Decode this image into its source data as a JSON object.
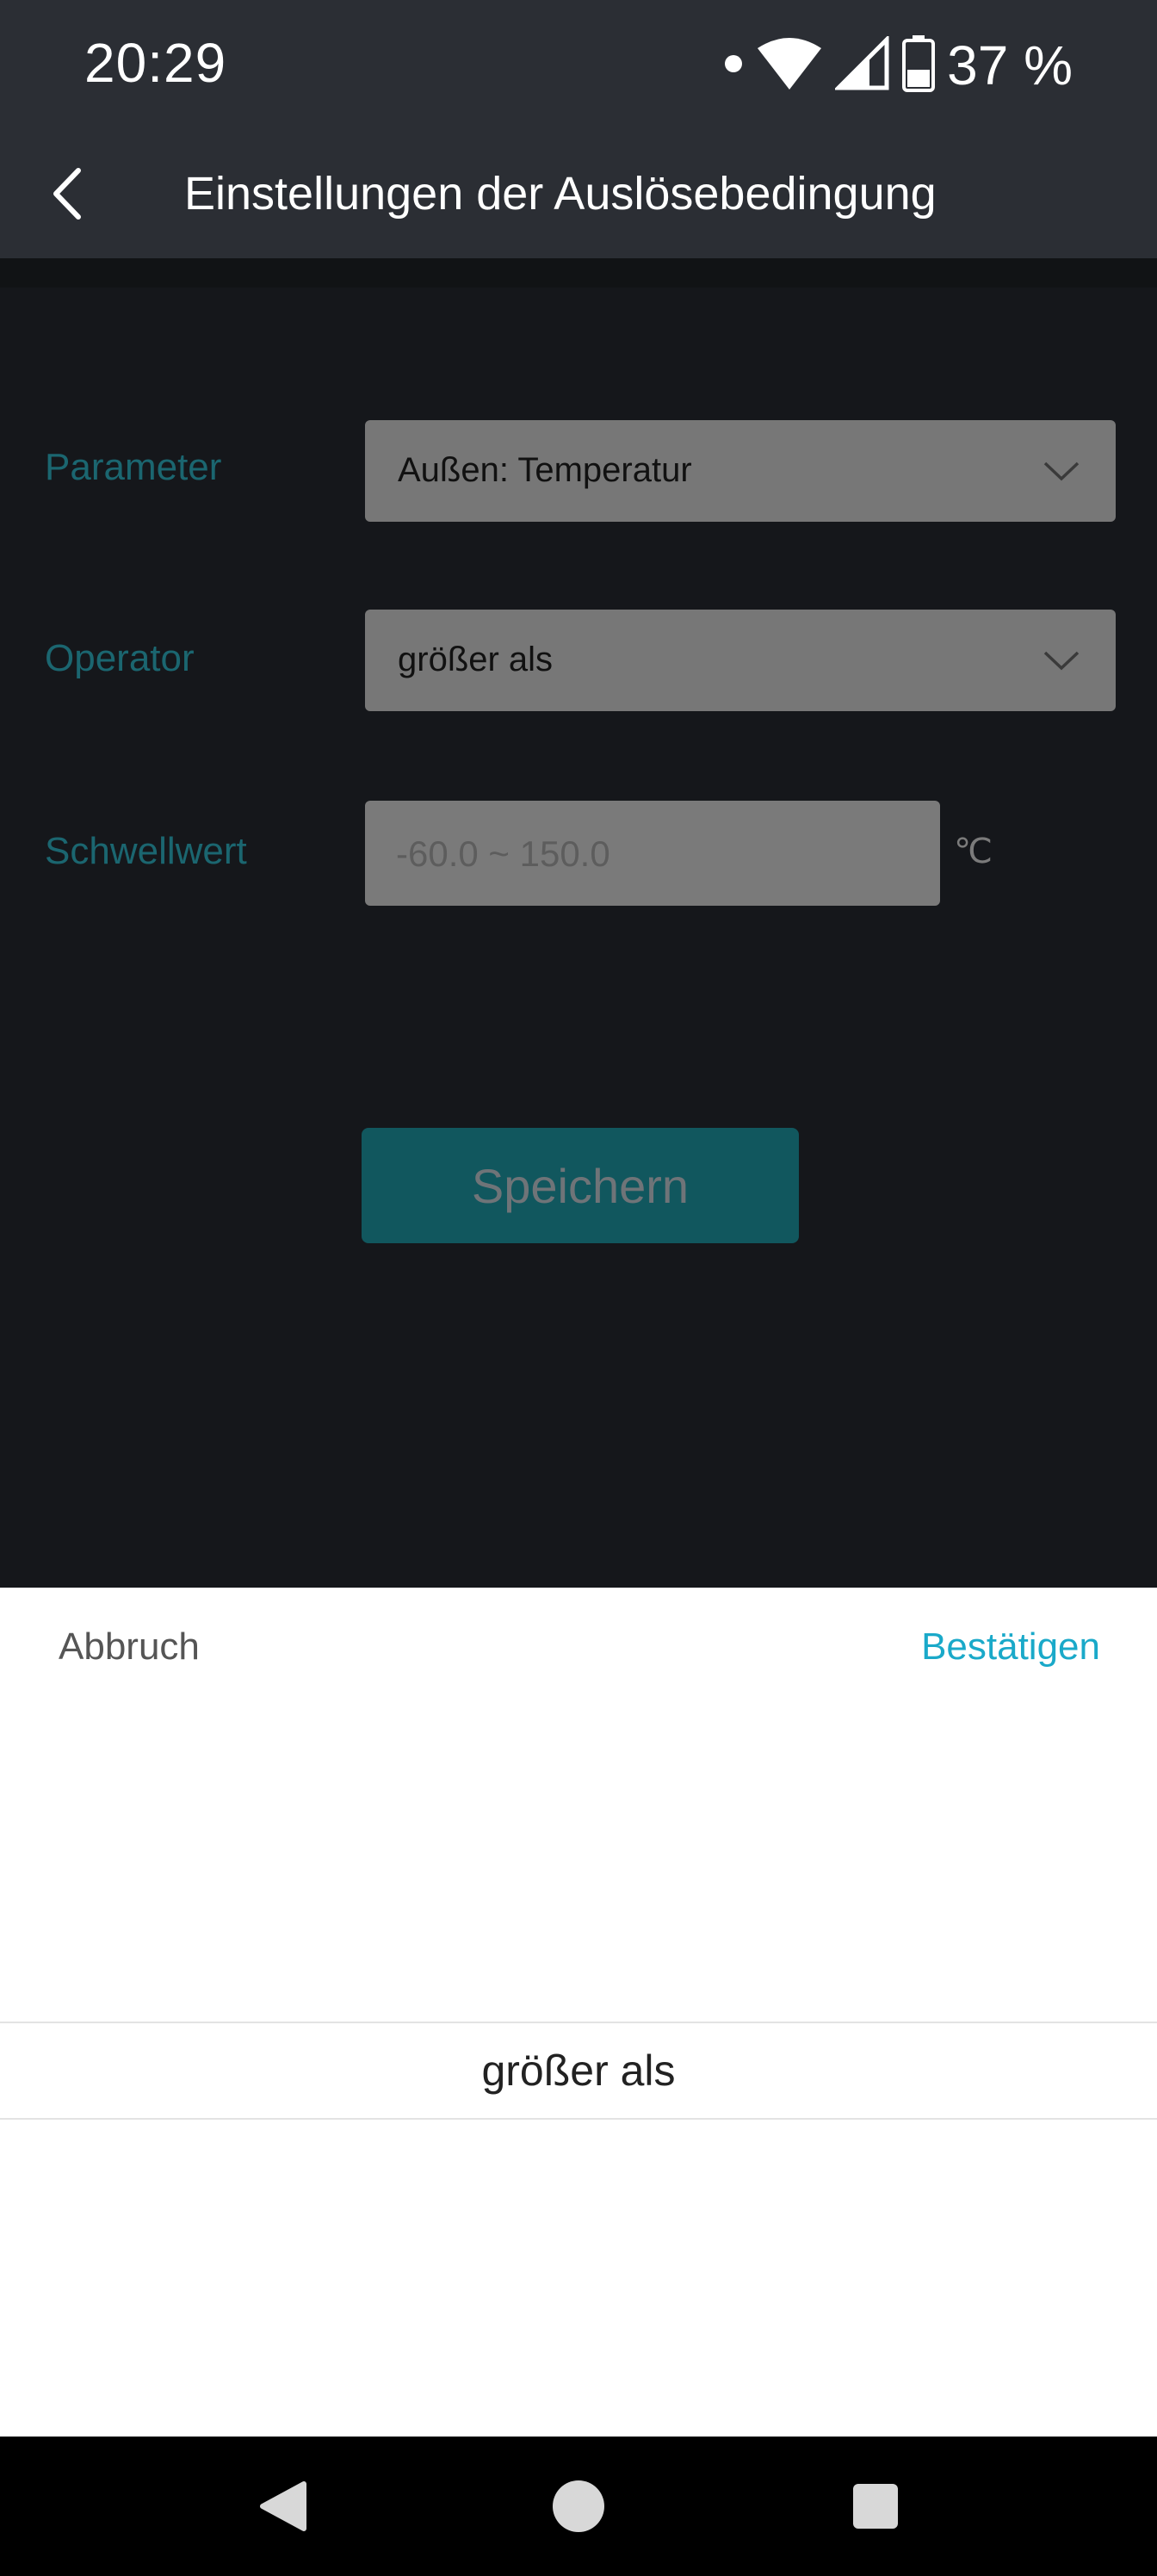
{
  "status_bar": {
    "time": "20:29",
    "battery": "37 %"
  },
  "header": {
    "title": "Einstellungen der Auslösebedingung"
  },
  "form": {
    "parameter_label": "Parameter",
    "parameter_value": "Außen: Temperatur",
    "operator_label": "Operator",
    "operator_value": "größer als",
    "threshold_label": "Schwellwert",
    "threshold_placeholder": "-60.0 ~ 150.0",
    "threshold_unit": "℃",
    "save_label": "Speichern"
  },
  "picker": {
    "cancel_label": "Abbruch",
    "confirm_label": "Bestätigen",
    "selected_option": "größer als"
  },
  "colors": {
    "accent": "#1aa9c9",
    "header_bg": "#2b2e34",
    "label": "#1b6670"
  },
  "icons": {
    "back": "chevron-left-icon",
    "dropdown": "chevron-down-icon",
    "nav_back": "triangle-back-icon",
    "nav_home": "circle-home-icon",
    "nav_recents": "square-recents-icon"
  }
}
